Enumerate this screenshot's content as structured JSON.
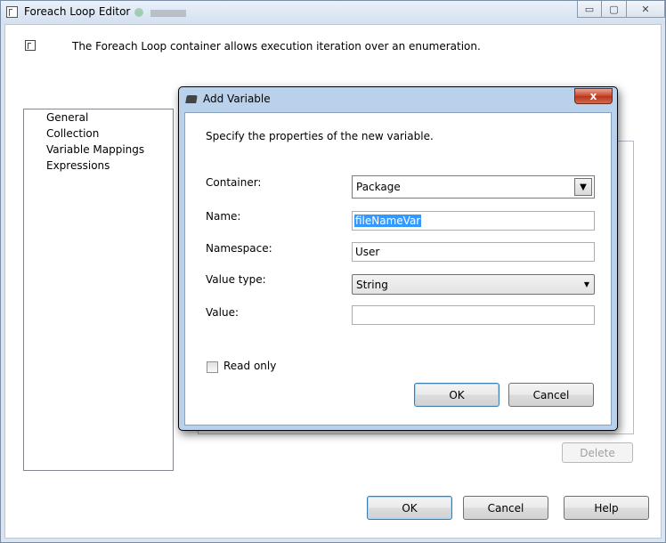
{
  "window": {
    "title": "Foreach Loop Editor",
    "description": "The Foreach Loop container allows execution iteration over an enumeration.",
    "caption_buttons": {
      "minimize": "▭",
      "maximize": "▢",
      "close": "✕"
    }
  },
  "nav": {
    "items": [
      {
        "label": "General"
      },
      {
        "label": "Collection"
      },
      {
        "label": "Variable Mappings"
      },
      {
        "label": "Expressions"
      }
    ]
  },
  "panel": {
    "delete_label": "Delete"
  },
  "footer": {
    "ok_label": "OK",
    "cancel_label": "Cancel",
    "help_label": "Help"
  },
  "dialog": {
    "title": "Add Variable",
    "close_symbol": "x",
    "description": "Specify the properties of the new variable.",
    "container": {
      "label": "Container:",
      "value": "Package"
    },
    "name": {
      "label": "Name:",
      "value": "fileNameVar"
    },
    "namespace": {
      "label": "Namespace:",
      "value": "User"
    },
    "value_type": {
      "label": "Value type:",
      "value": "String"
    },
    "value": {
      "label": "Value:",
      "value": ""
    },
    "read_only": {
      "label": "Read only",
      "checked": false
    },
    "ok_label": "OK",
    "cancel_label": "Cancel"
  }
}
